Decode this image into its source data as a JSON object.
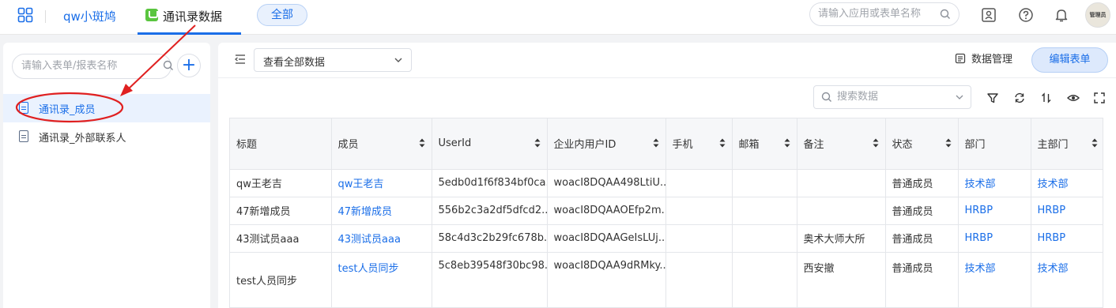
{
  "topbar": {
    "app_name": "qw小斑鸠",
    "active_tab": "通讯录数据",
    "scope_pill": "全部",
    "search_placeholder": "请输入应用或表单名称",
    "avatar_text": "管理员"
  },
  "sidebar": {
    "search_placeholder": "请输入表单/报表名称",
    "add_label": "+",
    "items": [
      {
        "label": "通讯录_成员",
        "active": true
      },
      {
        "label": "通讯录_外部联系人",
        "active": false
      }
    ]
  },
  "main": {
    "view_select": "查看全部数据",
    "data_mgmt_label": "数据管理",
    "edit_button": "编辑表单",
    "search_placeholder": "搜索数据",
    "columns": [
      "标题",
      "成员",
      "UserId",
      "企业内用户ID",
      "手机",
      "邮箱",
      "备注",
      "状态",
      "部门",
      "主部门"
    ],
    "rows": [
      {
        "title": "qw王老吉",
        "member": "qw王老吉",
        "userid": "5edb0d1f6f834bf0ca...",
        "corp_userid": "woacI8DQAA498LtiU...",
        "phone": "",
        "email": "",
        "note": "",
        "status": "普通成员",
        "dept": "技术部",
        "main_dept": "技术部"
      },
      {
        "title": "47新增成员",
        "member": "47新增成员",
        "userid": "556b2c3a2df5dfcd2...",
        "corp_userid": "woacI8DQAAOEfp2m...",
        "phone": "",
        "email": "",
        "note": "",
        "status": "普通成员",
        "dept": "HRBP",
        "main_dept": "HRBP"
      },
      {
        "title": "43测试员aaa",
        "member": "43测试员aaa",
        "userid": "58c4d3c2b29fc678b...",
        "corp_userid": "woacI8DQAAGeIsLUj...",
        "phone": "",
        "email": "",
        "note": "奥术大师大所",
        "status": "普通成员",
        "dept": "HRBP",
        "main_dept": "HRBP"
      },
      {
        "title": "test人员同步",
        "member": "test人员同步",
        "userid": "5c8eb39548f30bc98...",
        "corp_userid": "woacI8DQAA9dRMky...",
        "phone": "",
        "email": "",
        "note": "西安撤",
        "status": "普通成员",
        "dept": "技术部",
        "main_dept": "技术部"
      }
    ]
  },
  "colors": {
    "accent": "#1a6ee8",
    "annotation": "#e02020",
    "active_bg": "#eaf2fe"
  }
}
